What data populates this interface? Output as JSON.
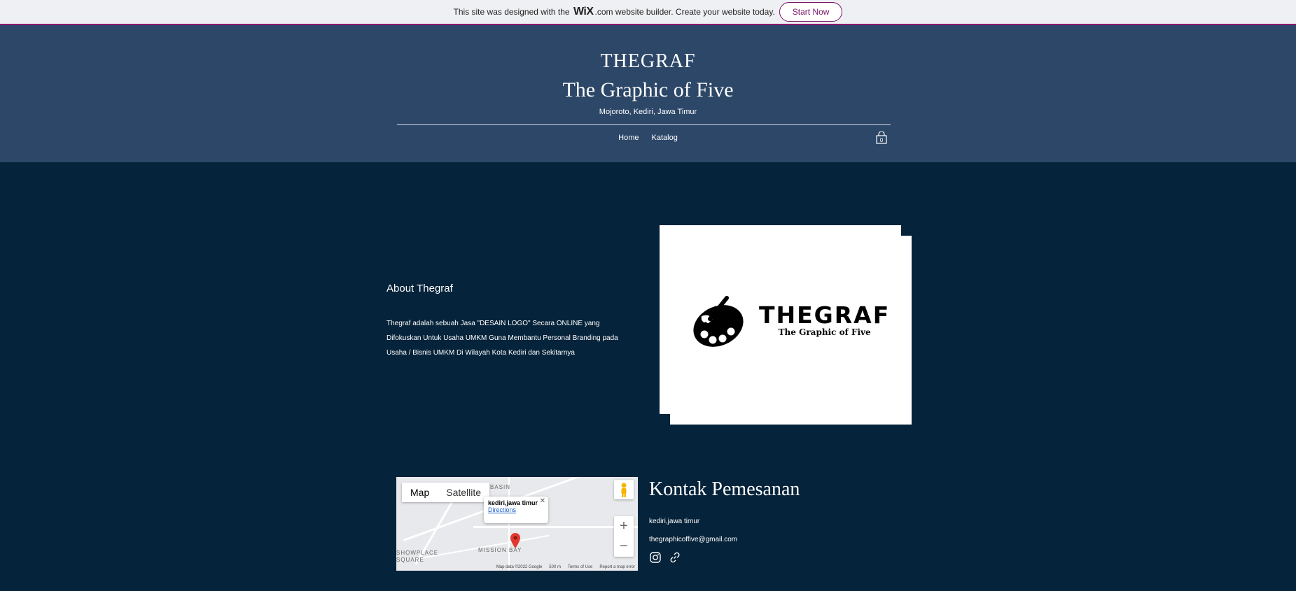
{
  "wix_banner": {
    "text_before": "This site was designed with the",
    "wix_logo": "WiX",
    "text_after": ".com website builder. Create your website today.",
    "cta": "Start Now"
  },
  "header": {
    "title1": "THEGRAF",
    "title2": "The Graphic of Five",
    "subtitle": "Mojoroto, Kediri, Jawa Timur",
    "nav": [
      "Home",
      "Katalog"
    ],
    "cart_count": "0"
  },
  "about": {
    "title": "About Thegraf",
    "text": "Thegraf adalah sebuah Jasa \"DESAIN LOGO\" Secara ONLINE yang Difokuskan Untuk Usaha UMKM Guna Membantu Personal Branding pada Usaha / Bisnis UMKM Di Wilayah Kota Kediri dan Sekitarnya"
  },
  "logo": {
    "main": "THEGRAF",
    "sub": "The Graphic of Five"
  },
  "map": {
    "tab_map": "Map",
    "tab_satellite": "Satellite",
    "popup_name": "kediri,jawa timur",
    "popup_link": "Directions",
    "labels": [
      "BASIN",
      "SHOWPLACE SQUARE",
      "MISSION BAY"
    ],
    "footer": [
      "Map data ©2022 Google",
      "500 m",
      "Terms of Use",
      "Report a map error"
    ]
  },
  "contact": {
    "title": "Kontak Pemesanan",
    "location": "kediri,jawa timur",
    "email": "thegraphicoffive@gmail.com"
  }
}
